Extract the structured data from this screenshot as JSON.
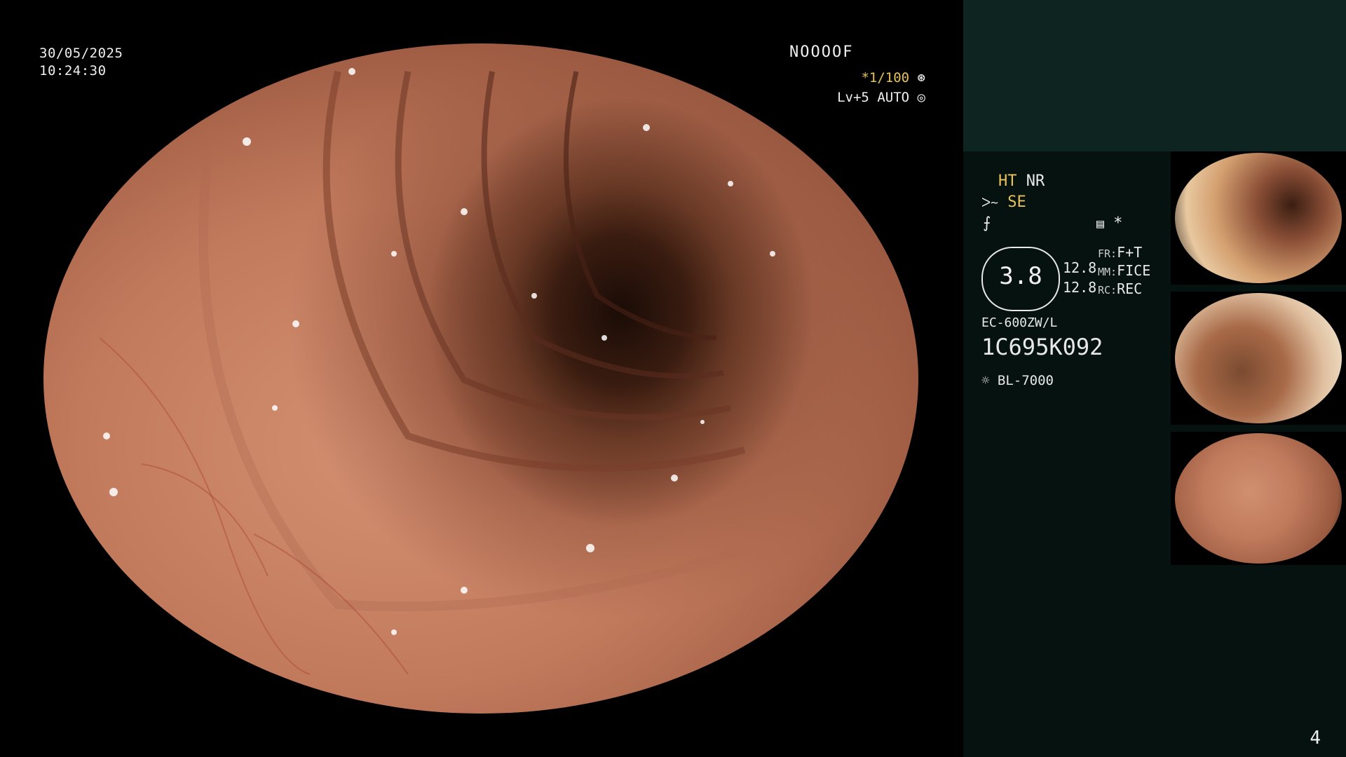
{
  "overlay": {
    "date": "30/05/2025",
    "time": "10:24:30",
    "patient_id": "NOOOOF",
    "shutter": "*1/100",
    "level": "Lv+5",
    "iris": "AUTO"
  },
  "panel": {
    "ht": "HT",
    "nr": "NR",
    "se": "SE",
    "gauge_value": "3.8",
    "value_a": "12.8",
    "value_b": "12.8",
    "fr_label": "FR:",
    "fr_value": "F+T",
    "mm_label": "MM:",
    "mm_value": "FICE",
    "rc_label": "RC:",
    "rc_value": "REC",
    "scope_model": "EC-600ZW/L",
    "scope_serial": "1C695K092",
    "light_source": "BL-7000",
    "asterisk": "*"
  },
  "page_number": "4",
  "icons": [
    "shutter-icon",
    "iris-icon",
    "enhancement-icon",
    "structure-icon",
    "record-icon",
    "light-source-icon"
  ],
  "colors": {
    "accent": "#e8c25a",
    "panel_bg": "#061210",
    "panel_top_bg": "#0d2420"
  }
}
